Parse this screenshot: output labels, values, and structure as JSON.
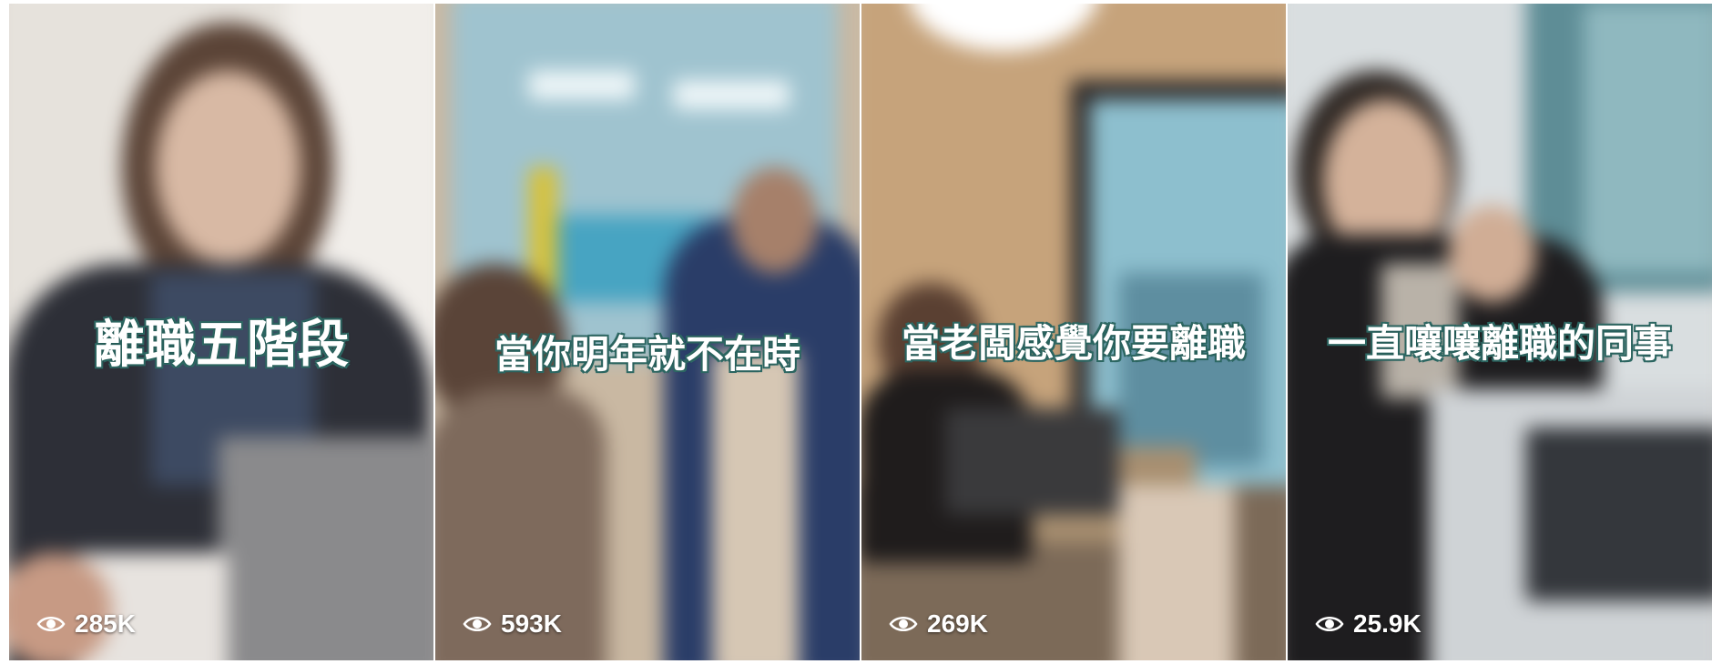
{
  "videos": [
    {
      "caption": "離職五階段",
      "views": "285K",
      "icon": "eye-icon"
    },
    {
      "caption": "當你明年就不在時",
      "views": "593K",
      "icon": "eye-icon"
    },
    {
      "caption": "當老闆感覺你要離職",
      "views": "269K",
      "icon": "eye-icon"
    },
    {
      "caption": "一直嚷嚷離職的同事",
      "views": "25.9K",
      "icon": "eye-icon"
    }
  ],
  "colors": {
    "caption_text": "#ffffff",
    "caption_outline": "#2f6b66",
    "view_count": "#ffffff"
  }
}
